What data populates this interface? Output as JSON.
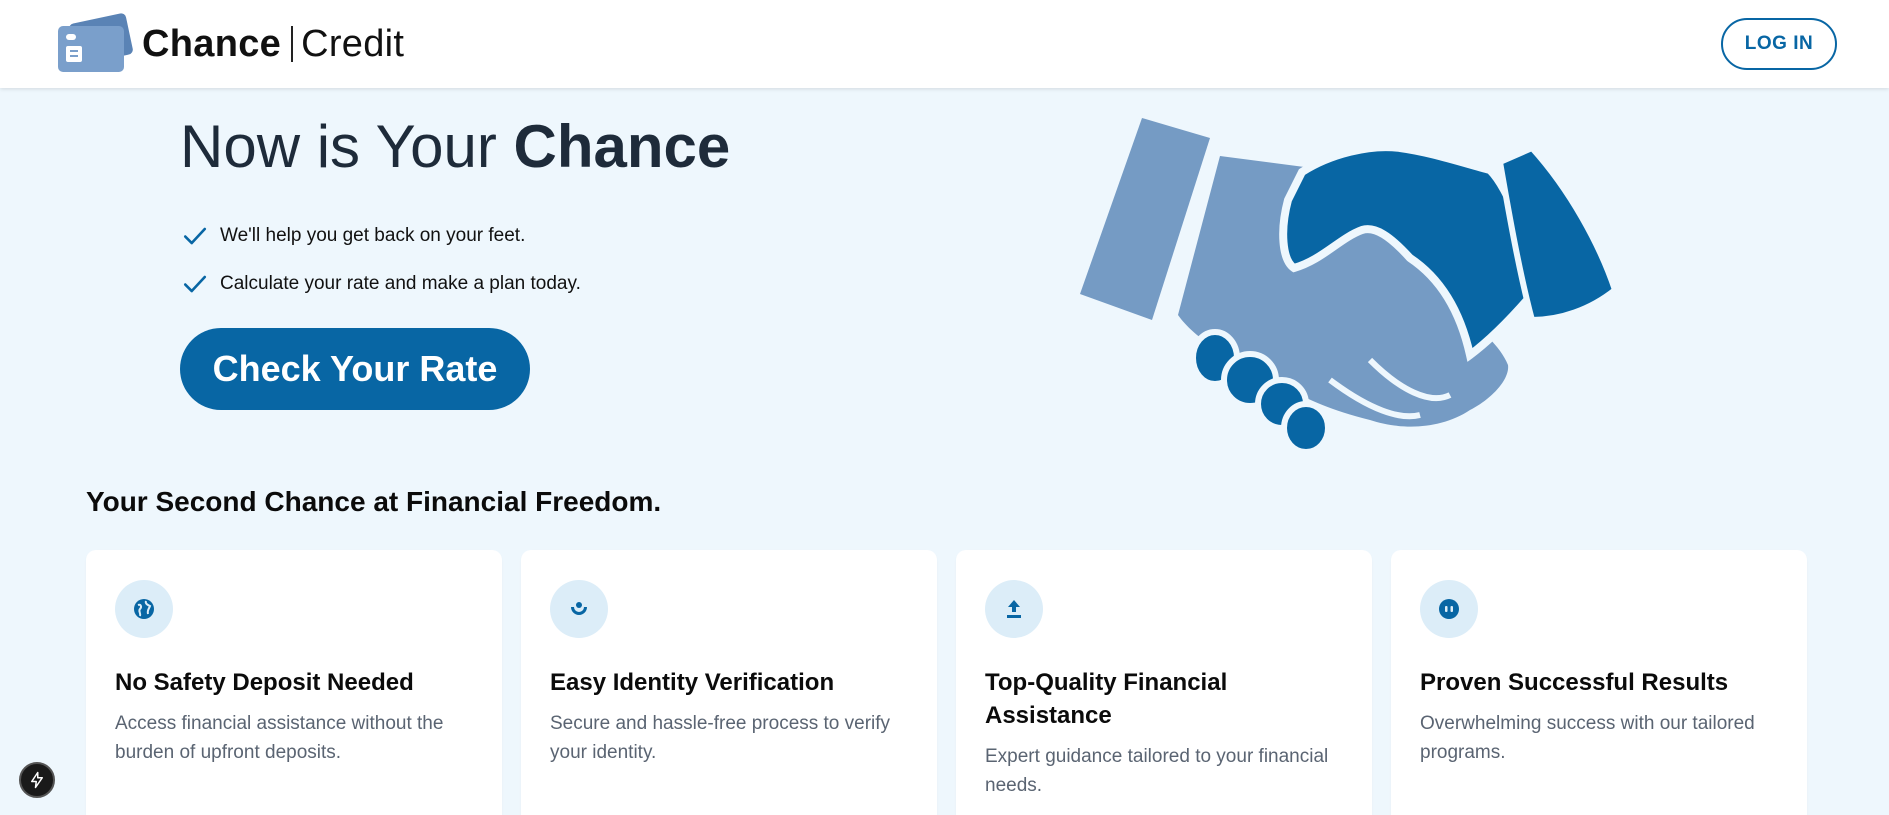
{
  "header": {
    "brand_part1": "Chance",
    "brand_part2": "Credit",
    "login_label": "LOG IN"
  },
  "hero": {
    "title_normal": "Now is Your ",
    "title_strong": "Chance",
    "checks": [
      "We'll help you get back on your feet.",
      "Calculate your rate and make a plan today."
    ],
    "cta_label": "Check Your Rate"
  },
  "features": {
    "section_title": "Your Second Chance at Financial Freedom.",
    "cards": [
      {
        "icon": "globe-icon",
        "title": "No Safety Deposit Needed",
        "text": "Access financial assistance without the burden of upfront deposits."
      },
      {
        "icon": "identity-icon",
        "title": "Easy Identity Verification",
        "text": "Secure and hassle-free process to verify your identity."
      },
      {
        "icon": "upload-icon",
        "title": "Top-Quality Financial Assistance",
        "text": "Expert guidance tailored to your financial needs."
      },
      {
        "icon": "results-icon",
        "title": "Proven Successful Results",
        "text": "Overwhelming success with our tailored programs."
      }
    ]
  },
  "colors": {
    "primary": "#0866a4",
    "light_blue": "#759bc4",
    "background": "#eef7fd",
    "icon_bg": "#dcedf8"
  }
}
